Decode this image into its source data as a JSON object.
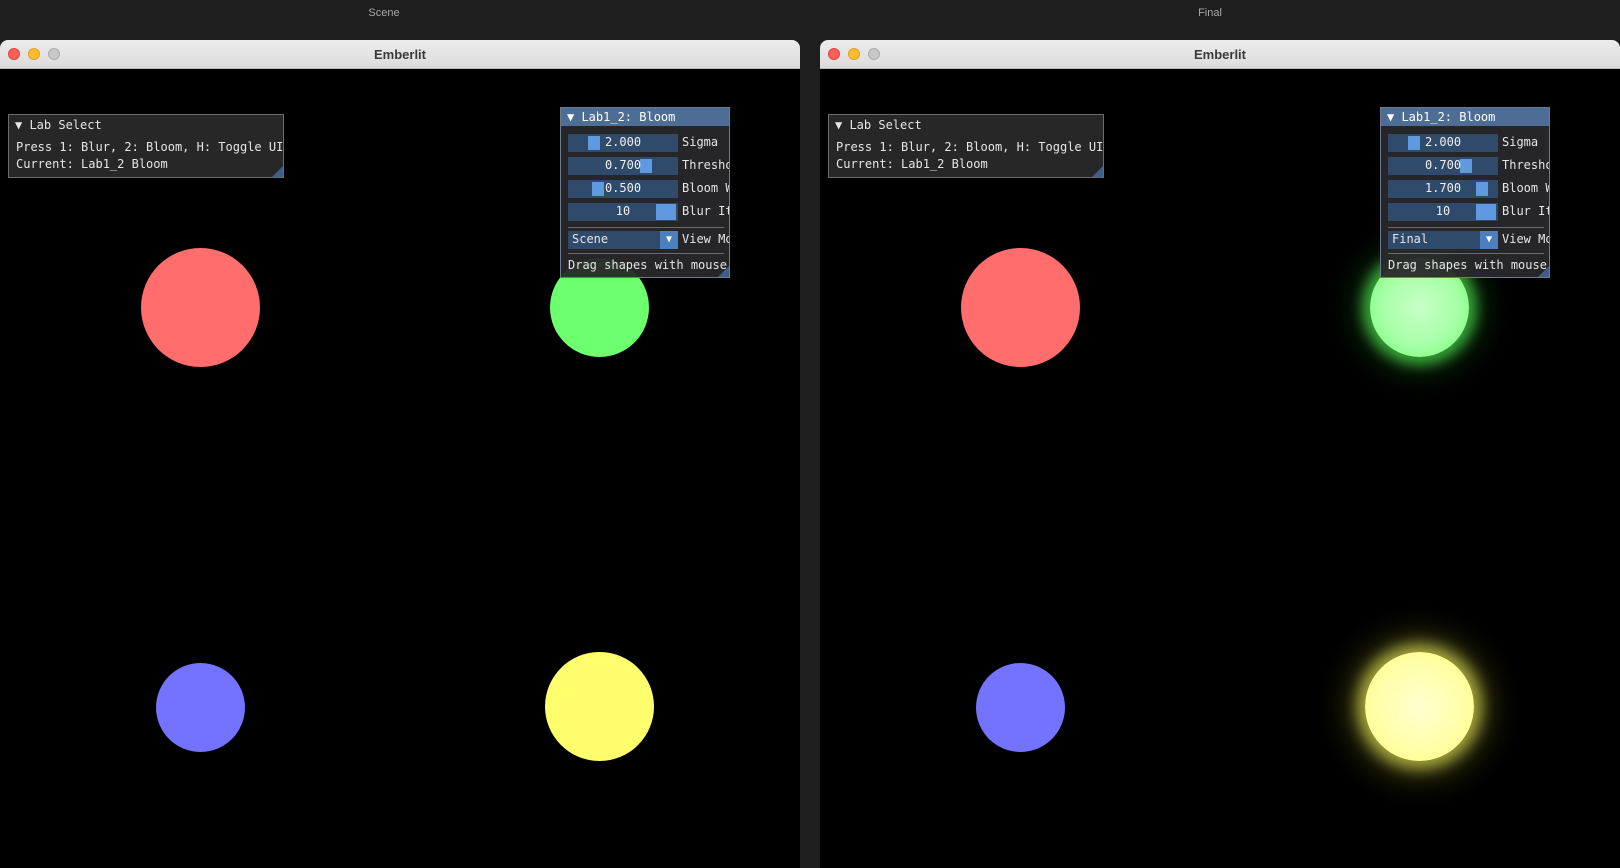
{
  "screen": {
    "captions": [
      "Scene",
      "Final"
    ]
  },
  "windows": [
    {
      "title": "Emberlit",
      "lab_select": {
        "header": "▼ Lab Select",
        "line1": "Press 1: Blur, 2: Bloom, H: Toggle UI",
        "line2": "Current: Lab1_2 Bloom"
      },
      "bloom_panel": {
        "header": "▼ Lab1_2: Bloom",
        "sliders": [
          {
            "value": "2.000",
            "label": "Sigma",
            "fraction": 0.2
          },
          {
            "value": "0.700",
            "label": "Threshold",
            "fraction": 0.7
          },
          {
            "value": "0.500",
            "label": "Bloom Weight",
            "fraction": 0.25
          },
          {
            "value": "10",
            "label": "Blur Iterations",
            "fraction": 1.0
          }
        ],
        "view_mode": {
          "value": "Scene",
          "label": "View Mode"
        },
        "hint": "Drag shapes with mouse"
      }
    },
    {
      "title": "Emberlit",
      "lab_select": {
        "header": "▼ Lab Select",
        "line1": "Press 1: Blur, 2: Bloom, H: Toggle UI",
        "line2": "Current: Lab1_2 Bloom"
      },
      "bloom_panel": {
        "header": "▼ Lab1_2: Bloom",
        "sliders": [
          {
            "value": "2.000",
            "label": "Sigma",
            "fraction": 0.2
          },
          {
            "value": "0.700",
            "label": "Threshold",
            "fraction": 0.7
          },
          {
            "value": "1.700",
            "label": "Bloom Weight",
            "fraction": 0.85
          },
          {
            "value": "10",
            "label": "Blur Iterations",
            "fraction": 1.0
          }
        ],
        "view_mode": {
          "value": "Final",
          "label": "View Mode"
        },
        "hint": "Drag shapes with mouse"
      }
    }
  ],
  "colors": {
    "red_shape": "#ff6d6d",
    "green_shape": "#6dff6d",
    "blue_shape": "#7373ff",
    "yellow_shape": "#ffff6d",
    "imgui_header": "#4d6d94"
  }
}
